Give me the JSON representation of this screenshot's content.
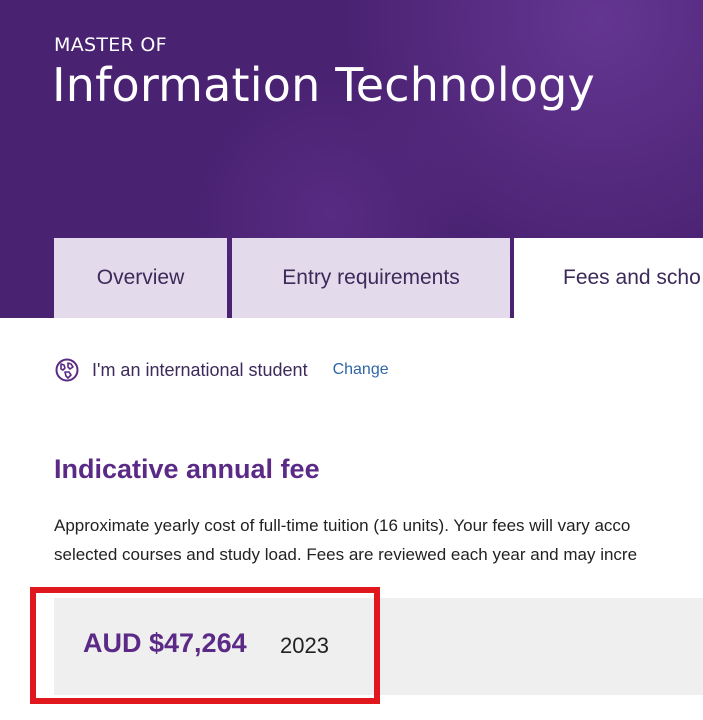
{
  "hero": {
    "kicker": "MASTER OF",
    "title": "Information Technology"
  },
  "tabs": [
    {
      "label": "Overview",
      "active": false
    },
    {
      "label": "Entry requirements",
      "active": false
    },
    {
      "label": "Fees and scho",
      "active": true
    }
  ],
  "student": {
    "icon": "globe-icon",
    "text": "I'm an international student",
    "change_label": "Change"
  },
  "fee": {
    "heading": "Indicative annual fee",
    "description_line1": "Approximate yearly cost of full-time tuition (16 units). Your fees will vary acco",
    "description_line2": "selected courses and study load. Fees are reviewed each year and may incre",
    "amount": "AUD $47,264",
    "year": "2023"
  },
  "colors": {
    "hero_bg": "#4a2272",
    "tab_inactive": "#e3dbec",
    "heading": "#5a2a86",
    "link": "#2f66a6",
    "highlight": "#e1171e"
  }
}
